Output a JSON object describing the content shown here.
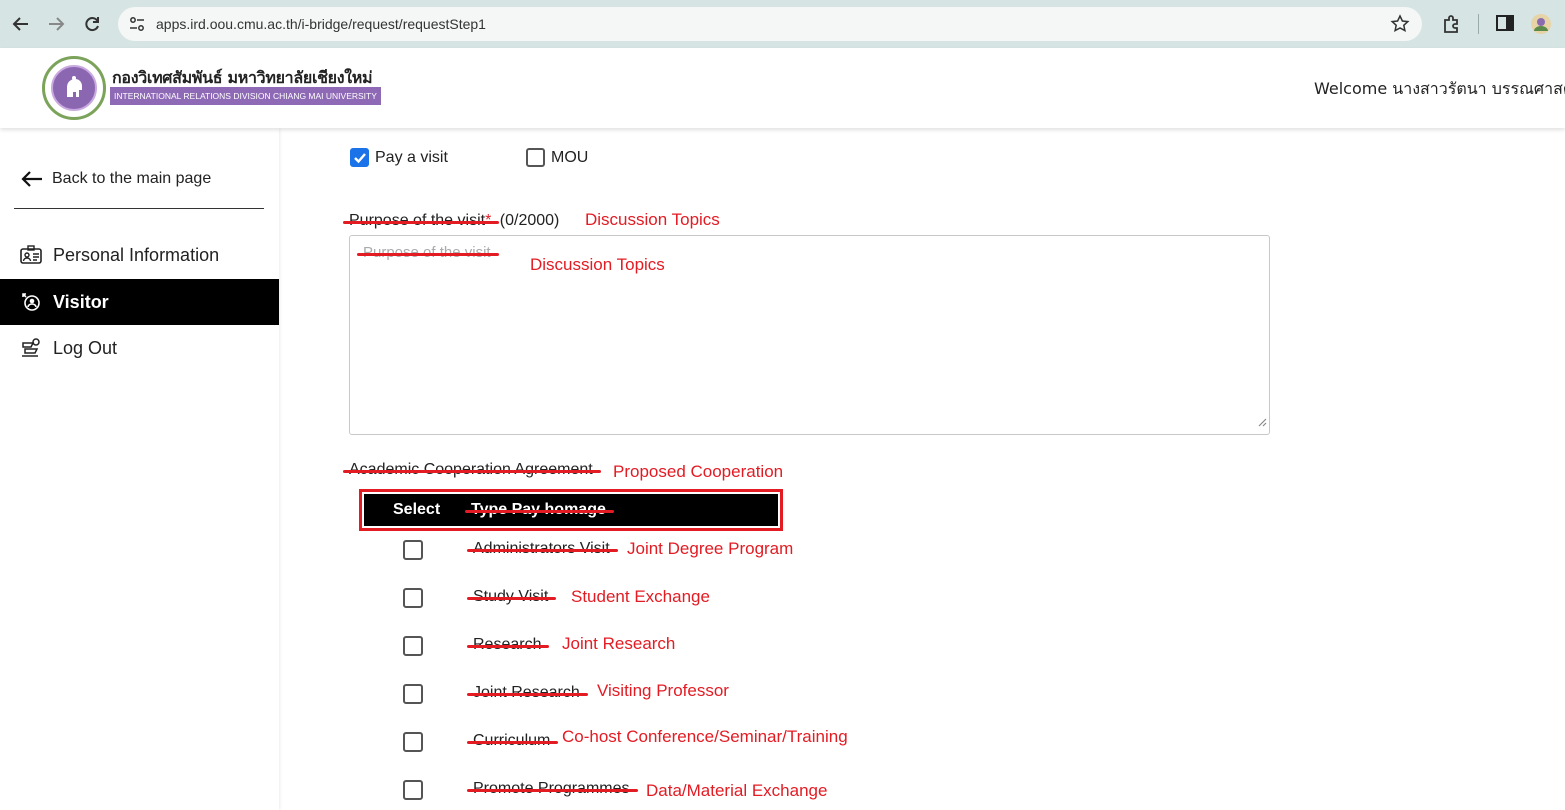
{
  "browser": {
    "url": "apps.ird.oou.cmu.ac.th/i-bridge/request/requestStep1"
  },
  "header": {
    "org_name_th": "กองวิเทศสัมพันธ์ มหาวิทยาลัยเชียงใหม่",
    "org_name_en": "INTERNATIONAL RELATIONS DIVISION CHIANG MAI UNIVERSITY",
    "welcome_text": "Welcome นางสาวรัตนา บรรณศาสตร์"
  },
  "sidebar": {
    "back_label": "Back to the main page",
    "items": [
      {
        "label": "Personal Information",
        "icon": "id-card-icon",
        "active": false
      },
      {
        "label": "Visitor",
        "icon": "visitor-icon",
        "active": true
      },
      {
        "label": "Log Out",
        "icon": "logout-icon",
        "active": false
      }
    ]
  },
  "form": {
    "request_types": [
      {
        "label": "Pay a visit",
        "checked": true
      },
      {
        "label": "MOU",
        "checked": false
      }
    ],
    "purpose": {
      "label": "Purpose of the visit",
      "required_mark": "*",
      "counter": "(0/2000)",
      "annotation": "Discussion Topics",
      "placeholder": "Purpose of the visit",
      "placeholder_annotation": "Discussion Topics"
    },
    "agreement": {
      "label": "Academic Cooperation Agreement",
      "annotation": "Proposed Cooperation",
      "table_header": {
        "select": "Select",
        "type": "Type Pay homage"
      },
      "rows": [
        {
          "label": "Administrators Visit",
          "annotation": "Joint Degree Program",
          "checked": false
        },
        {
          "label": "Study Visit",
          "annotation": "Student Exchange",
          "checked": false
        },
        {
          "label": "Research",
          "annotation": "Joint Research",
          "checked": false
        },
        {
          "label": "Joint Research",
          "annotation": "Visiting Professor",
          "checked": false
        },
        {
          "label": "Curriculum",
          "annotation": "Co-host Conference/Seminar/Training",
          "checked": false
        },
        {
          "label": "Promote Programmes",
          "annotation": "Data/Material Exchange",
          "checked": false
        }
      ]
    }
  },
  "colors": {
    "annotation_red": "#e31b23",
    "active_nav": "#000000",
    "brand_purple": "#8e69b6",
    "checkbox_blue": "#1a73e8"
  }
}
